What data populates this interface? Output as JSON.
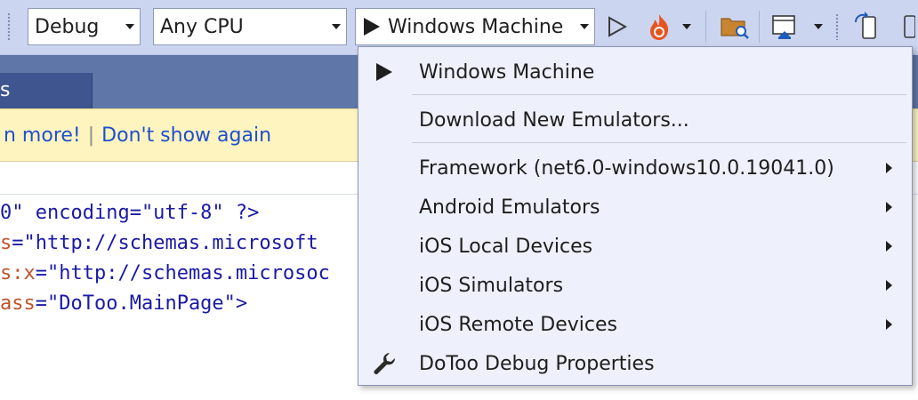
{
  "toolbar": {
    "configuration": "Debug",
    "platform": "Any CPU",
    "target": "Windows Machine"
  },
  "tabs": [
    {
      "label": "s"
    }
  ],
  "infobar": {
    "learn_more": "n more!",
    "separator": "|",
    "dont_show": "Don't show again"
  },
  "code": {
    "line1": {
      "kw": "0\" encoding=\"utf-8\" ?>"
    },
    "line2": {
      "attr": "s",
      "eq": "=",
      "val": "\"http://schemas.microsoft"
    },
    "line3": {
      "attr": "s:x",
      "eq": "=",
      "val": "\"http://schemas.microsoc"
    },
    "line4": {
      "attr": "ass",
      "eq": "=",
      "val": "\"DoToo.MainPage\">"
    }
  },
  "menu": {
    "items": [
      {
        "label": "Windows Machine",
        "icon": "play-icon"
      },
      {
        "label": "Download New Emulators..."
      },
      {
        "label": "Framework (net6.0-windows10.0.19041.0)",
        "submenu": true
      },
      {
        "label": "Android Emulators",
        "submenu": true
      },
      {
        "label": "iOS Local Devices",
        "submenu": true
      },
      {
        "label": "iOS Simulators",
        "submenu": true
      },
      {
        "label": "iOS Remote Devices",
        "submenu": true
      },
      {
        "label": "DoToo Debug Properties",
        "icon": "wrench-icon"
      }
    ]
  },
  "colors": {
    "toolbar_bg": "#ccd5f0",
    "menu_bg": "#eef0fb",
    "infobar_bg": "#fdf4bf",
    "link": "#1f4fd0",
    "tab_strip": "#5f77a8",
    "hot_reload": "#e8541e"
  }
}
